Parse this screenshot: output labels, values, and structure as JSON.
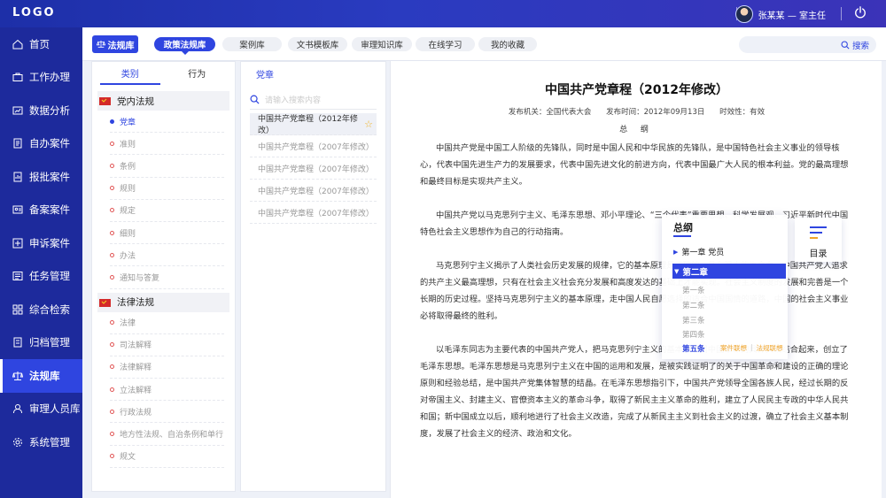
{
  "header": {
    "logo": "LOGO",
    "user_name": "张某某 — 室主任"
  },
  "sidebar": {
    "items": [
      {
        "label": "首页",
        "icon": "home-icon"
      },
      {
        "label": "工作办理",
        "icon": "briefcase-icon"
      },
      {
        "label": "数据分析",
        "icon": "chart-icon"
      },
      {
        "label": "自办案件",
        "icon": "document-icon"
      },
      {
        "label": "报批案件",
        "icon": "report-icon"
      },
      {
        "label": "备案案件",
        "icon": "id-card-icon"
      },
      {
        "label": "申诉案件",
        "icon": "appeal-icon"
      },
      {
        "label": "任务管理",
        "icon": "task-icon"
      },
      {
        "label": "综合检索",
        "icon": "grid-icon"
      },
      {
        "label": "归档管理",
        "icon": "archive-icon"
      },
      {
        "label": "法规库",
        "icon": "scale-icon",
        "active": true
      },
      {
        "label": "审理人员库",
        "icon": "user-icon"
      },
      {
        "label": "系统管理",
        "icon": "gear-icon"
      }
    ]
  },
  "toolbar": {
    "library_button": "法规库",
    "tabs": [
      "政策法规库",
      "案例库",
      "文书模板库",
      "审理知识库",
      "在线学习",
      "我的收藏"
    ],
    "active_tab": "政策法规库",
    "search_label": "搜索"
  },
  "category": {
    "tabs": [
      "类别",
      "行为"
    ],
    "active_tab": "类别",
    "groups": [
      {
        "title": "党内法规",
        "items": [
          "党章",
          "准则",
          "条例",
          "规则",
          "规定",
          "细则",
          "办法",
          "通知与答复"
        ]
      },
      {
        "title": "法律法规",
        "items": [
          "法律",
          "司法解释",
          "法律解释",
          "立法解释",
          "行政法规",
          "地方性法规、自治条例和单行",
          "规文"
        ]
      }
    ],
    "active_item": "党章"
  },
  "list": {
    "title": "党章",
    "search_placeholder": "请输入搜索内容",
    "items": [
      "中国共产党章程（2012年修改）",
      "中国共产党章程（2007年修改）",
      "中国共产党章程（2007年修改）",
      "中国共产党章程（2007年修改）",
      "中国共产党章程（2007年修改）"
    ]
  },
  "document": {
    "title": "中国共产党章程（2012年修改）",
    "meta": {
      "issuer": "发布机关：全国代表大会",
      "date": "发布时间：2012年09月13日",
      "validity": "时效性：有效"
    },
    "subtitle": "总 纲",
    "paragraphs": [
      "中国共产党是中国工人阶级的先锋队，同时是中国人民和中华民族的先锋队，是中国特色社会主义事业的领导核心，代表中国先进生产力的发展要求，代表中国先进文化的前进方向，代表中国最广大人民的根本利益。党的最高理想和最终目标是实现共产主义。",
      "中国共产党以马克思列宁主义、毛泽东思想、邓小平理论、“三个代表”重要思想、科学发展观、习近平新时代中国特色社会主义思想作为自己的行动指南。",
      "马克思列宁主义揭示了人类社会历史发展的规律，它的基本原理是正确的，具有强大的生命力。中国共产党人追求的共产主义最高理想，只有在社会主义社会充分发展和高度发达的基础上才能实现。社会主义制度的发展和完善是一个长期的历史过程。坚持马克思列宁主义的基本原理，走中国人民自愿选择的适合中国国情的道路，中国的社会主义事业必将取得最终的胜利。",
      "以毛泽东同志为主要代表的中国共产党人，把马克思列宁主义的基本原理同中国革命的具体实践结合起来，创立了毛泽东思想。毛泽东思想是马克思列宁主义在中国的运用和发展，是被实践证明了的关于中国革命和建设的正确的理论原则和经验总结，是中国共产党集体智慧的结晶。在毛泽东思想指引下，中国共产党领导全国各族人民，经过长期的反对帝国主义、封建主义、官僚资本主义的革命斗争，取得了新民主主义革命的胜利，建立了人民民主专政的中华人民共和国；新中国成立以后，顺利地进行了社会主义改造，完成了从新民主主义到社会主义的过渡，确立了社会主义基本制度，发展了社会主义的经济、政治和文化。"
    ]
  },
  "outline": {
    "title": "总纲",
    "chapter1": "第一章  党员",
    "chapter2": "第二章",
    "articles": [
      "第一条",
      "第二条",
      "第三条",
      "第四条",
      "第五条"
    ],
    "active_article": "第五条",
    "link_case": "案件联想",
    "link_sep": "|",
    "link_law": "法规联想",
    "toc_label": "目录"
  },
  "colors": {
    "primary": "#2f45e0",
    "sidebar": "#1d2a9c",
    "accent_orange": "#f0a42a",
    "dot_red": "#e15656"
  }
}
